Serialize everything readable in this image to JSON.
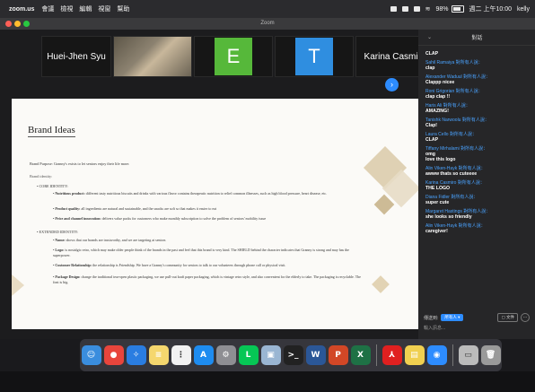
{
  "menubar": {
    "app": "zoom.us",
    "items": [
      "會議",
      "檢視",
      "編輯",
      "視窗",
      "幫助"
    ],
    "battery": "98%",
    "clock": "週二 上午10:00",
    "user": "kelly"
  },
  "window": {
    "title": "Zoom",
    "traffic_colors": [
      "#ff5f57",
      "#febc2e",
      "#28c840"
    ]
  },
  "participants": [
    {
      "name": "Huei-Jhen Syu"
    },
    {
      "name": ""
    },
    {
      "initial": "E",
      "color": "#56b83a"
    },
    {
      "initial": "T",
      "color": "#2f8ee0"
    },
    {
      "name": "Karina Casmiro"
    }
  ],
  "slide": {
    "title": "Brand Ideas",
    "purpose": "Brand Purpose: Granny's exists to let seniors enjoy their life more.",
    "identity": "Brand identity:",
    "core_heading": "CORE IDENTITY:",
    "core_items": [
      {
        "label": "Nutritious product:",
        "text": "different tasty nutritious biscuits and drinks with various flavor contains therapeutic nutrition to relief common illnesses, such as high blood pressure, heart disease, etc."
      },
      {
        "label": "Product quality:",
        "text": "all ingredients are natural and sustainable, and the snacks are soft so that makes it easier to eat"
      },
      {
        "label": "Price and channel innovation:",
        "text": "delivers value packs for customers who make monthly subscription to solve the problem of seniors' mobility issue"
      }
    ],
    "extended_heading": "EXTENDED IDENTITY:",
    "extended_items": [
      {
        "label": "Name:",
        "text": "shows that our brands are trustworthy, and we are targeting at seniors"
      },
      {
        "label": "Logo:",
        "text": "is nostalgic retro, which may make older people think of the brands in the past and feel that this brand is very kind. The SHIELD behind the character indicates that Granny is strong and may has the superpower."
      },
      {
        "label": "Customer Relationship:",
        "text": "the relationship is Friendship. We have a Granny's community for seniors to talk to our volunteers through phone call or physical visit."
      },
      {
        "label": "Package Design:",
        "text": "change the traditional tear-open plastic packaging, we use pull-out kraft paper packaging, which is vintage retro style, and also convenient for the elderly to take. The packaging is recyclable. The font is big."
      }
    ]
  },
  "chat": {
    "title": "對話",
    "messages": [
      {
        "from": "",
        "text": "CLAP"
      },
      {
        "from": "Sahil Ramaiya 對所有人說：",
        "text": "clap"
      },
      {
        "from": "Alexander Waduul 對所有人說：",
        "text": "Clappp nicee"
      },
      {
        "from": "Roni Grigorian 對所有人說：",
        "text": "clap clap !!"
      },
      {
        "from": "Haris Ali 對所有人說：",
        "text": "AMAZING!"
      },
      {
        "from": "Tanishk Narwoolu 對所有人說：",
        "text": "Clap!"
      },
      {
        "from": "Laura Cello 對所有人說：",
        "text": "CLAP"
      },
      {
        "from": "Tiffany Mirhalami 對所有人說：",
        "text": "omg\nlove this logo"
      },
      {
        "from": "Alin Viken-Hayk 對所有人說：",
        "text": "awww thats so cuteeee"
      },
      {
        "from": "Karina Casmiro 對所有人說：",
        "text": "THE LOGO"
      },
      {
        "from": "Diana Fidler 對所有人說：",
        "text": "super cute"
      },
      {
        "from": "Margaret Hastings 對所有人說：",
        "text": "she looks so friendly"
      },
      {
        "from": "Alin Viken-Hayk 對所有人說：",
        "text": "caregiver!"
      }
    ],
    "to_label": "傳送到:",
    "to_value": "所有人 ▾",
    "file_label": "文件",
    "input_placeholder": "輸入訊息..."
  },
  "dock": {
    "apps": [
      {
        "name": "finder",
        "color": "#3a8dde",
        "glyph": "☺"
      },
      {
        "name": "chrome",
        "color": "#e8453c",
        "glyph": "●"
      },
      {
        "name": "safari",
        "color": "#2a7de1",
        "glyph": "✧"
      },
      {
        "name": "notes",
        "color": "#f5d76e",
        "glyph": "≡"
      },
      {
        "name": "reminders",
        "color": "#f2f2f2",
        "glyph": "⋮"
      },
      {
        "name": "app-store",
        "color": "#1e8cf0",
        "glyph": "A"
      },
      {
        "name": "system-preferences",
        "color": "#8e8e93",
        "glyph": "⚙"
      },
      {
        "name": "line",
        "color": "#06c755",
        "glyph": "L"
      },
      {
        "name": "preview",
        "color": "#9ab6d3",
        "glyph": "▣"
      },
      {
        "name": "terminal",
        "color": "#222222",
        "glyph": ">_"
      },
      {
        "name": "word",
        "color": "#2b5797",
        "glyph": "W"
      },
      {
        "name": "powerpoint",
        "color": "#d24726",
        "glyph": "P"
      },
      {
        "name": "excel",
        "color": "#1e7145",
        "glyph": "X"
      },
      {
        "name": "acrobat",
        "color": "#e02020",
        "glyph": "⅄"
      },
      {
        "name": "stickies",
        "color": "#f0d050",
        "glyph": "▤"
      },
      {
        "name": "zoom",
        "color": "#2d8cff",
        "glyph": "◉"
      },
      {
        "name": "display",
        "color": "#bbbbbb",
        "glyph": "▭"
      },
      {
        "name": "trash",
        "color": "#9a9a9a",
        "glyph": "🗑"
      }
    ]
  }
}
